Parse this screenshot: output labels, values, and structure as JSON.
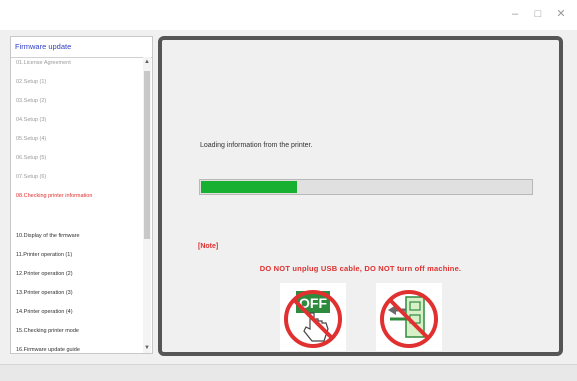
{
  "window": {
    "controls": {
      "minimize": "–",
      "maximize": "□",
      "close": "✕"
    }
  },
  "sidebar": {
    "header": "Firmware update",
    "items": [
      {
        "label": "01.License Agreement",
        "state": "done"
      },
      {
        "label": "02.Setup (1)",
        "state": "done"
      },
      {
        "label": "03.Setup (2)",
        "state": "done"
      },
      {
        "label": "04.Setup (3)",
        "state": "done"
      },
      {
        "label": "05.Setup (4)",
        "state": "done"
      },
      {
        "label": "06.Setup (5)",
        "state": "done"
      },
      {
        "label": "07.Setup (6)",
        "state": "done"
      },
      {
        "label": "08.Checking printer information",
        "state": "active"
      },
      {
        "label": "10.Display of the firmware",
        "state": "pending"
      },
      {
        "label": "11.Printer operation (1)",
        "state": "pending"
      },
      {
        "label": "12.Printer operation (2)",
        "state": "pending"
      },
      {
        "label": "13.Printer operation (3)",
        "state": "pending"
      },
      {
        "label": "14.Printer operation (4)",
        "state": "pending"
      },
      {
        "label": "15.Checking printer mode",
        "state": "pending"
      },
      {
        "label": "16.Firmware update guide",
        "state": "pending"
      }
    ],
    "scroll_up": "▲",
    "scroll_down": "▼"
  },
  "main": {
    "loading_text": "Loading information from the printer.",
    "progress_fraction": 0.29,
    "note_label": "[Note]",
    "warning": "DO NOT unplug USB cable, DO NOT turn off machine.",
    "off_label": "OFF",
    "icons": [
      "no-power-off-icon",
      "no-unplug-usb-icon"
    ]
  },
  "colors": {
    "accent_red": "#e03030",
    "progress_green": "#18b030",
    "header_blue": "#3040c8"
  }
}
